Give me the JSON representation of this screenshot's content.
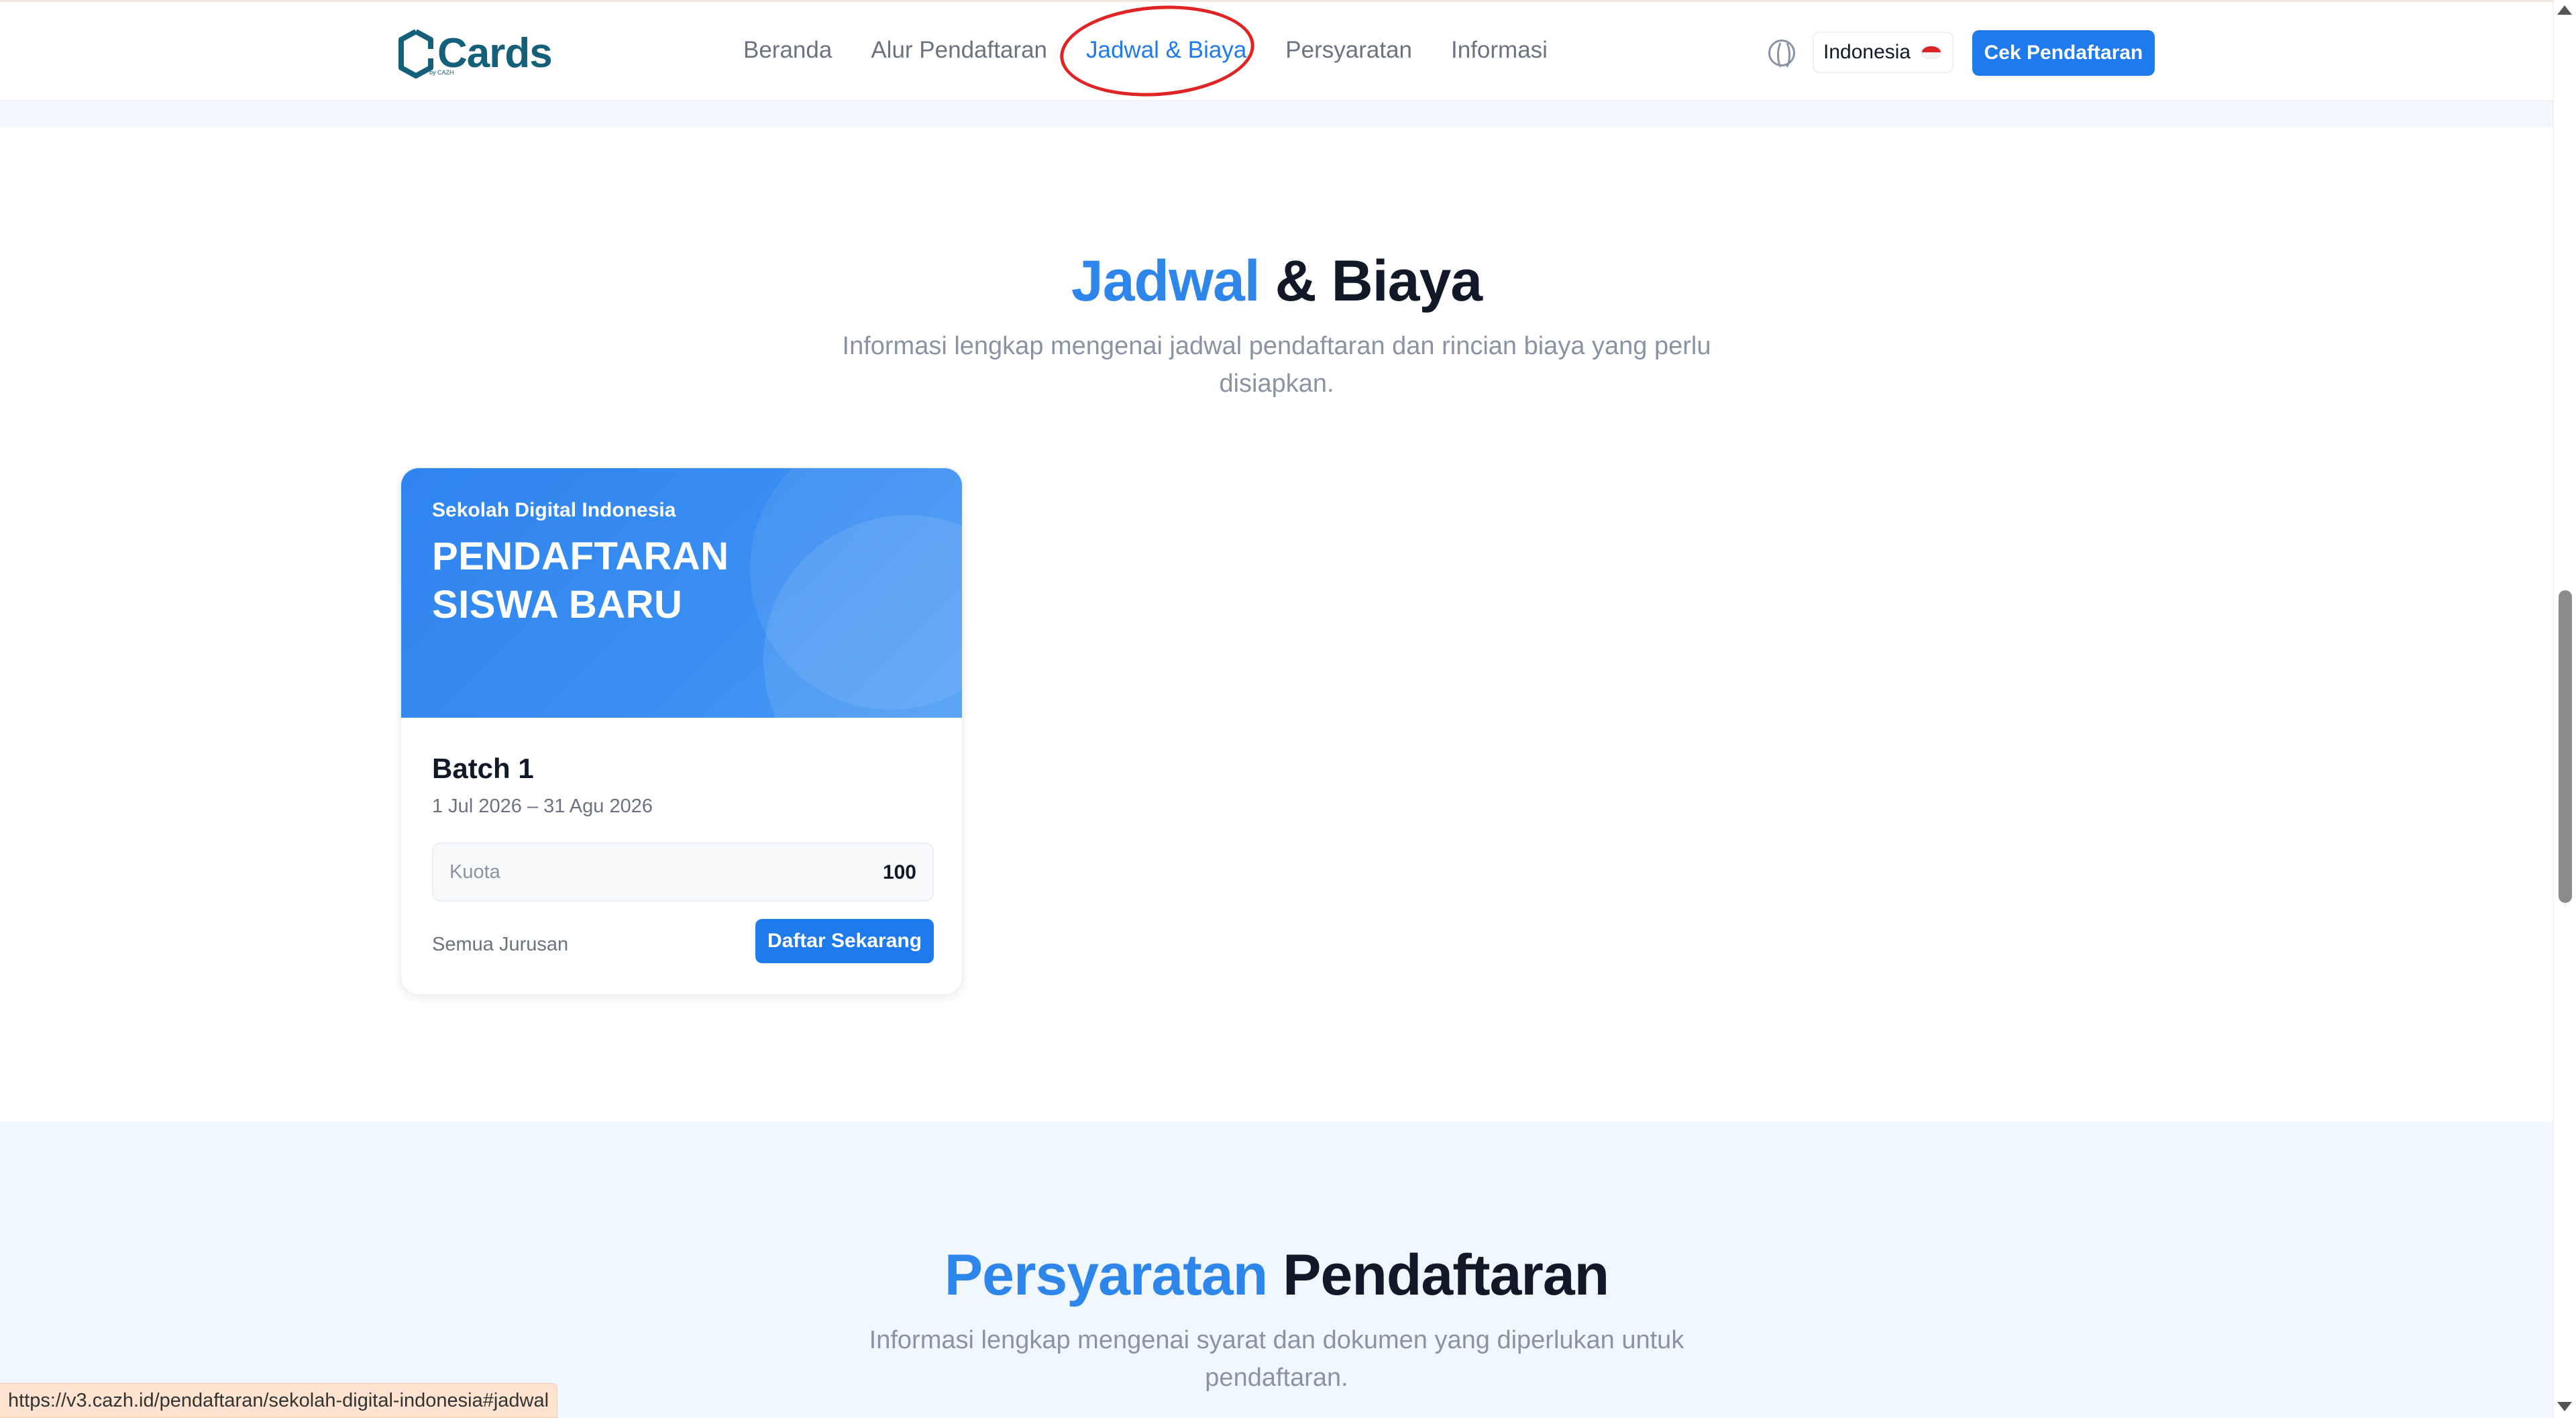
{
  "header": {
    "logo_text": "Cards",
    "logo_sub": "by CAZH",
    "nav": [
      {
        "label": "Beranda",
        "active": false
      },
      {
        "label": "Alur Pendaftaran",
        "active": false
      },
      {
        "label": "Jadwal & Biaya",
        "active": true
      },
      {
        "label": "Persyaratan",
        "active": false
      },
      {
        "label": "Informasi",
        "active": false
      }
    ],
    "language_label": "Indonesia",
    "check_button_label": "Cek Pendaftaran"
  },
  "schedule_section": {
    "title_highlight": "Jadwal",
    "title_rest": "& Biaya",
    "subtitle": "Informasi lengkap mengenai jadwal pendaftaran dan rincian biaya yang perlu disiapkan."
  },
  "card": {
    "school_name": "Sekolah Digital Indonesia",
    "hero_title": "PENDAFTARAN SISWA BARU",
    "batch_title": "Batch 1",
    "batch_dates": "1 Jul 2026 – 31 Agu 2026",
    "quota_label": "Kuota",
    "quota_value": "100",
    "major_label": "Semua Jurusan",
    "register_button_label": "Daftar Sekarang"
  },
  "requirements_section": {
    "title_highlight": "Persyaratan",
    "title_rest": "Pendaftaran",
    "subtitle": "Informasi lengkap mengenai syarat dan dokumen yang diperlukan untuk pendaftaran."
  },
  "status_url": "https://v3.cazh.id/pendaftaran/sekolah-digital-indonesia#jadwal",
  "colors": {
    "accent": "#1f7aec",
    "highlight": "#2f86ea",
    "annotation_circle": "#e02424"
  }
}
